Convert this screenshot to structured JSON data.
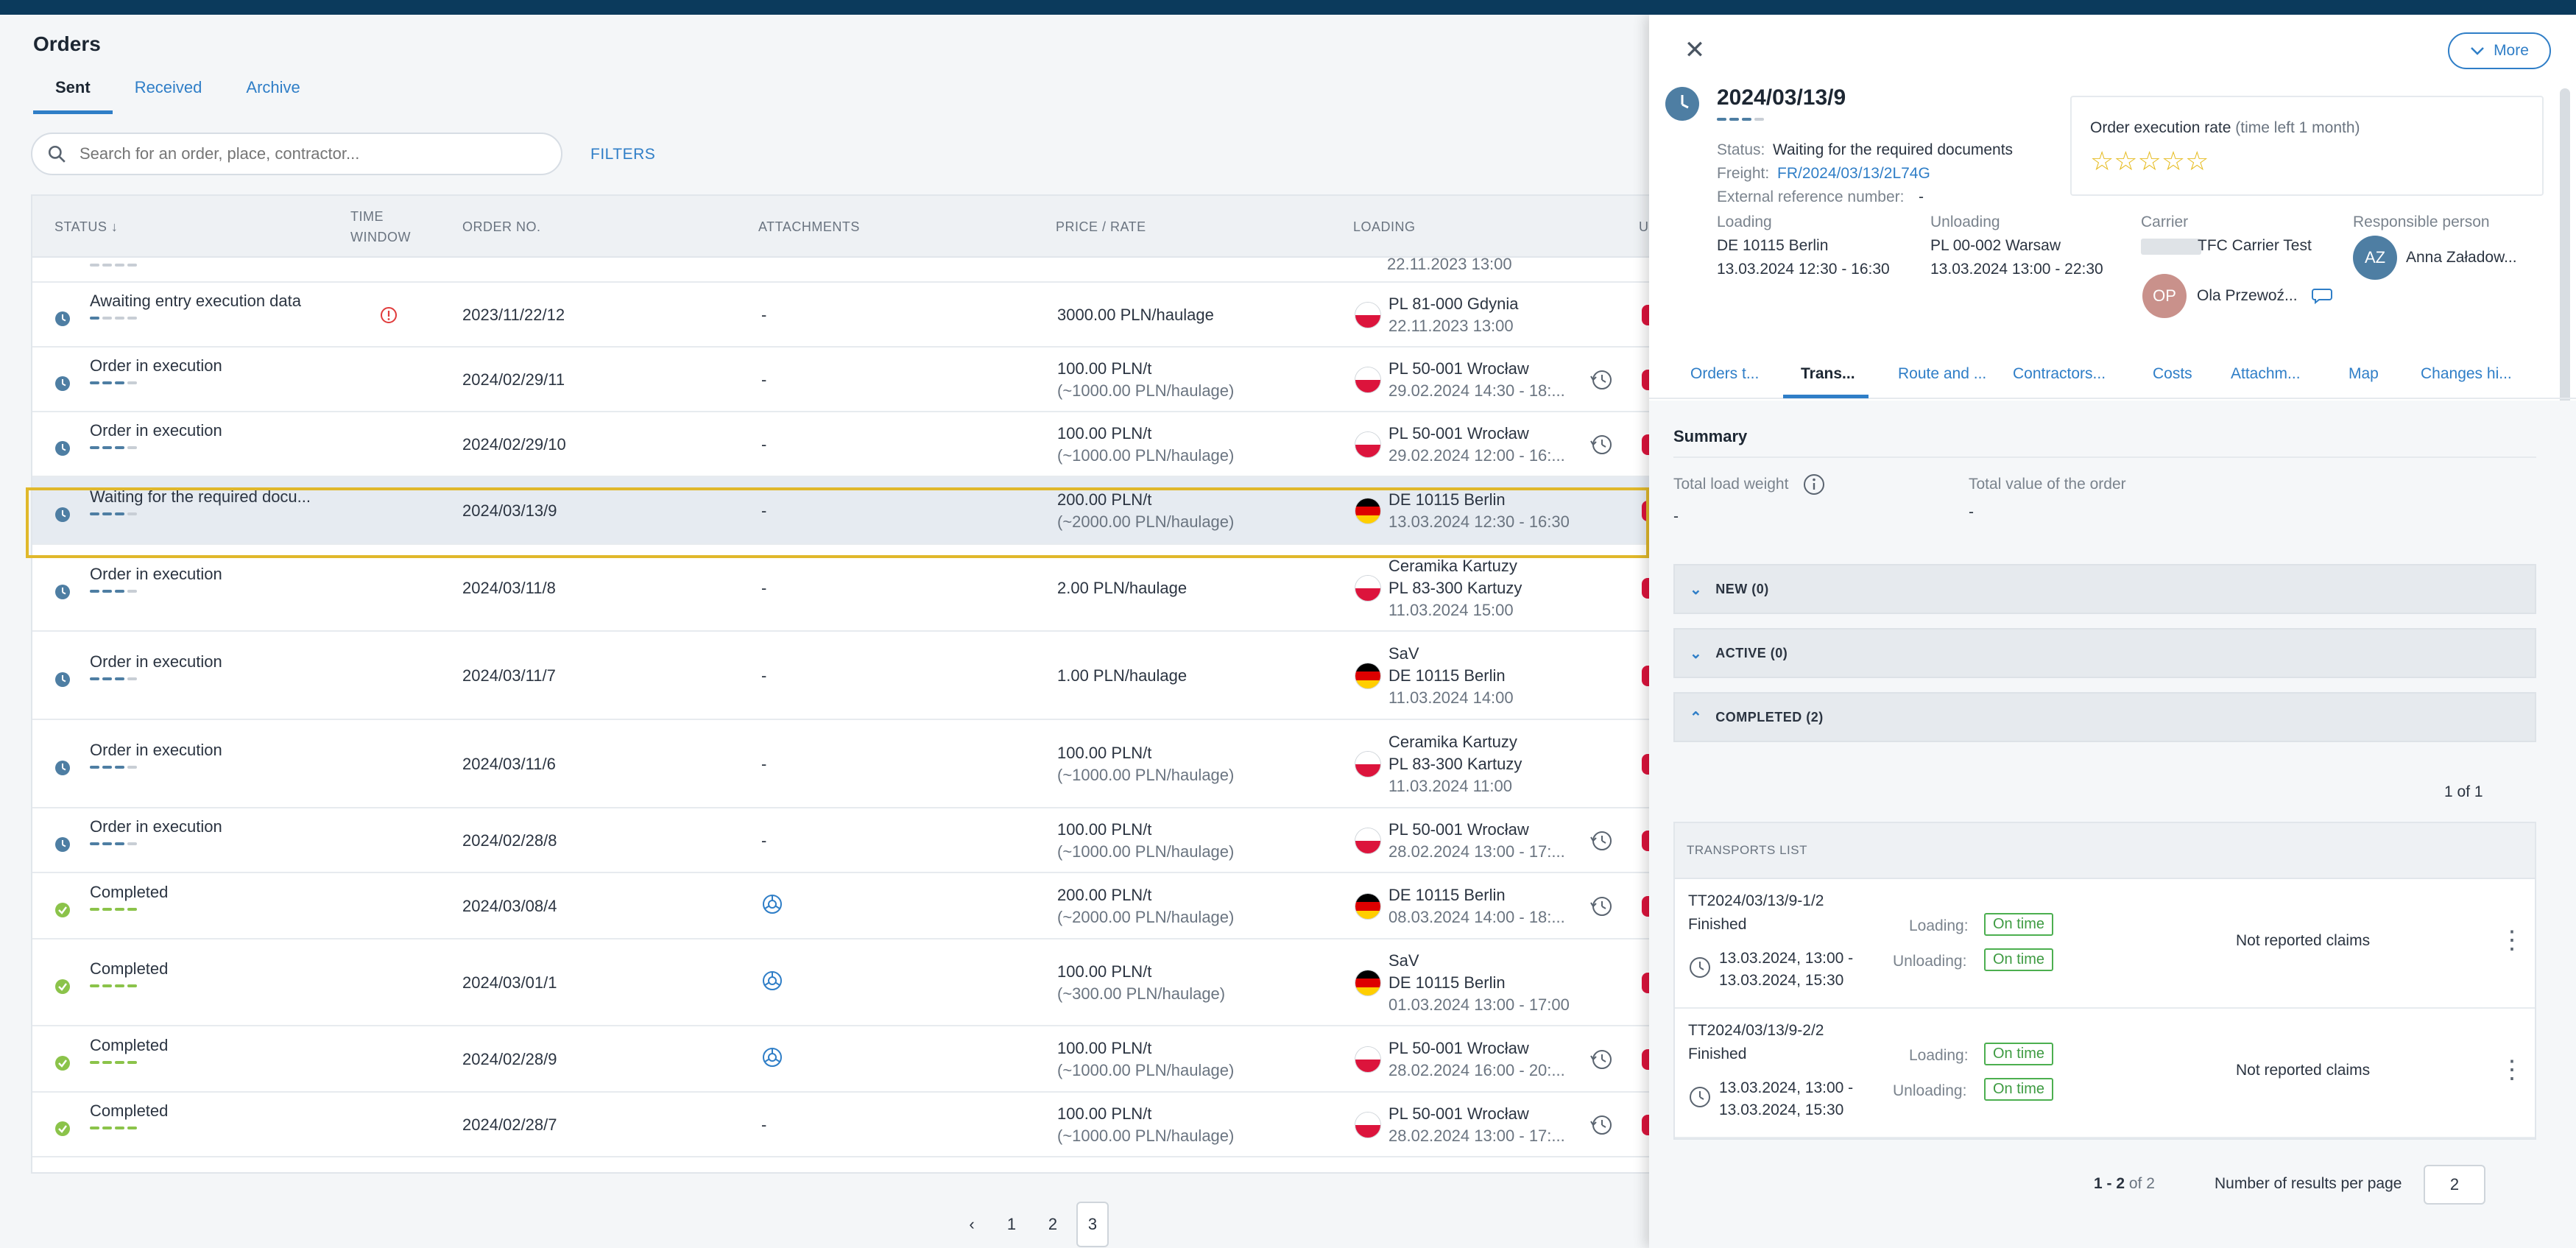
{
  "page": {
    "title": "Orders",
    "tabs": [
      "Sent",
      "Received",
      "Archive"
    ],
    "search_placeholder": "Search for an order, place, contractor...",
    "filters_label": "FILTERS"
  },
  "table": {
    "headers": {
      "status": "STATUS ↓",
      "time_window": "TIME\nWINDOW",
      "order_no": "ORDER NO.",
      "attachments": "ATTACHMENTS",
      "price": "PRICE / RATE",
      "loading": "LOADING",
      "unloading": "U"
    },
    "partial_row": {
      "loading_date": "22.11.2023 13:00"
    },
    "rows": [
      {
        "status": "Awaiting entry execution data",
        "kind": "pending",
        "alert": true,
        "order_no": "2023/11/22/12",
        "attachments": "-",
        "price1": "3000.00 PLN/haulage",
        "price2": "",
        "load_lines": [
          "PL 81-000 Gdynia",
          "22.11.2023 13:00"
        ],
        "flag": "pl",
        "history": false
      },
      {
        "status": "Order in execution",
        "kind": "exec",
        "alert": false,
        "order_no": "2024/02/29/11",
        "attachments": "-",
        "price1": "100.00 PLN/t",
        "price2": "(~1000.00 PLN/haulage)",
        "load_lines": [
          "PL 50-001 Wrocław",
          "29.02.2024 14:30 - 18:..."
        ],
        "flag": "pl",
        "history": true
      },
      {
        "status": "Order in execution",
        "kind": "exec",
        "alert": false,
        "order_no": "2024/02/29/10",
        "attachments": "-",
        "price1": "100.00 PLN/t",
        "price2": "(~1000.00 PLN/haulage)",
        "load_lines": [
          "PL 50-001 Wrocław",
          "29.02.2024 12:00 - 16:..."
        ],
        "flag": "pl",
        "history": true
      },
      {
        "status": "Waiting for the required docu...",
        "kind": "exec",
        "alert": false,
        "order_no": "2024/03/13/9",
        "attachments": "-",
        "price1": "200.00 PLN/t",
        "price2": "(~2000.00 PLN/haulage)",
        "load_lines": [
          "DE 10115 Berlin",
          "13.03.2024 12:30 - 16:30"
        ],
        "flag": "de",
        "history": false,
        "selected": true
      },
      {
        "status": "Order in execution",
        "kind": "exec",
        "alert": false,
        "order_no": "2024/03/11/8",
        "attachments": "-",
        "price1": "2.00 PLN/haulage",
        "price2": "",
        "load_lines": [
          "Ceramika Kartuzy",
          "PL 83-300 Kartuzy",
          "11.03.2024 15:00"
        ],
        "flag": "pl",
        "history": false
      },
      {
        "status": "Order in execution",
        "kind": "exec",
        "alert": false,
        "order_no": "2024/03/11/7",
        "attachments": "-",
        "price1": "1.00 PLN/haulage",
        "price2": "",
        "load_lines": [
          "SaV",
          "DE 10115 Berlin",
          "11.03.2024 14:00"
        ],
        "flag": "de",
        "history": false
      },
      {
        "status": "Order in execution",
        "kind": "exec",
        "alert": false,
        "order_no": "2024/03/11/6",
        "attachments": "-",
        "price1": "100.00 PLN/t",
        "price2": "(~1000.00 PLN/haulage)",
        "load_lines": [
          "Ceramika Kartuzy",
          "PL 83-300 Kartuzy",
          "11.03.2024 11:00"
        ],
        "flag": "pl",
        "history": false
      },
      {
        "status": "Order in execution",
        "kind": "exec",
        "alert": false,
        "order_no": "2024/02/28/8",
        "attachments": "-",
        "price1": "100.00 PLN/t",
        "price2": "(~1000.00 PLN/haulage)",
        "load_lines": [
          "PL 50-001 Wrocław",
          "28.02.2024 13:00 - 17:..."
        ],
        "flag": "pl",
        "history": true
      },
      {
        "status": "Completed",
        "kind": "done",
        "alert": false,
        "order_no": "2024/03/08/4",
        "attachments": "icon",
        "price1": "200.00 PLN/t",
        "price2": "(~2000.00 PLN/haulage)",
        "load_lines": [
          "DE 10115 Berlin",
          "08.03.2024 14:00 - 18:..."
        ],
        "flag": "de",
        "history": true
      },
      {
        "status": "Completed",
        "kind": "done",
        "alert": false,
        "order_no": "2024/03/01/1",
        "attachments": "icon",
        "price1": "100.00 PLN/t",
        "price2": "(~300.00 PLN/haulage)",
        "load_lines": [
          "SaV",
          "DE 10115 Berlin",
          "01.03.2024 13:00 - 17:00"
        ],
        "flag": "de",
        "history": false
      },
      {
        "status": "Completed",
        "kind": "done",
        "alert": false,
        "order_no": "2024/02/28/9",
        "attachments": "icon",
        "price1": "100.00 PLN/t",
        "price2": "(~1000.00 PLN/haulage)",
        "load_lines": [
          "PL 50-001 Wrocław",
          "28.02.2024 16:00 - 20:..."
        ],
        "flag": "pl",
        "history": true
      },
      {
        "status": "Completed",
        "kind": "done",
        "alert": false,
        "order_no": "2024/02/28/7",
        "attachments": "-",
        "price1": "100.00 PLN/t",
        "price2": "(~1000.00 PLN/haulage)",
        "load_lines": [
          "PL 50-001 Wrocław",
          "28.02.2024 13:00 - 17:..."
        ],
        "flag": "pl",
        "history": true
      }
    ]
  },
  "pagination": {
    "prev": "‹",
    "pages": [
      "1",
      "2",
      "3"
    ],
    "active": "3"
  },
  "panel": {
    "close": "✕",
    "more_label": "More",
    "order_no": "2024/03/13/9",
    "status_label": "Status:",
    "status_value": "Waiting for the required documents",
    "freight_label": "Freight:",
    "freight_value": "FR/2024/03/13/2L74G",
    "extref_label": "External reference number:",
    "extref_value": "-",
    "rate_title": "Order execution rate",
    "rate_hint": "(time left 1 month)",
    "stars": "☆☆☆☆☆",
    "loading_label": "Loading",
    "loading_place": "DE 10115 Berlin",
    "loading_time": "13.03.2024 12:30 - 16:30",
    "unloading_label": "Unloading",
    "unloading_place": "PL 00-002 Warsaw",
    "unloading_time": "13.03.2024 13:00 - 22:30",
    "carrier_label": "Carrier",
    "carrier_name": "TFC Carrier Test",
    "carrier_person": "Ola Przewoź...",
    "carrier_initials": "OP",
    "responsible_label": "Responsible person",
    "responsible_name": "Anna Załadow...",
    "responsible_initials": "AZ",
    "tabs": [
      "Orders t...",
      "Trans...",
      "Route and ...",
      "Contractors...",
      "Costs",
      "Attachm...",
      "Map",
      "Changes hi..."
    ],
    "summary_title": "Summary",
    "total_weight_label": "Total load weight",
    "total_weight_value": "-",
    "total_value_label": "Total value of the order",
    "total_value_value": "-",
    "sections": [
      "NEW (0)",
      "ACTIVE (0)",
      "COMPLETED (2)"
    ],
    "page_info": "1 of 1",
    "transports_header": "TRANSPORTS LIST",
    "transports": [
      {
        "id": "TT2024/03/13/9-1/2",
        "state": "Finished",
        "loading_label": "Loading:",
        "loading_badge": "On time",
        "unloading_label": "Unloading:",
        "unloading_badge": "On time",
        "time1": "13.03.2024, 13:00 -",
        "time2": "13.03.2024, 15:30",
        "claims": "Not reported claims"
      },
      {
        "id": "TT2024/03/13/9-2/2",
        "state": "Finished",
        "loading_label": "Loading:",
        "loading_badge": "On time",
        "unloading_label": "Unloading:",
        "unloading_badge": "On time",
        "time1": "13.03.2024, 13:00 -",
        "time2": "13.03.2024, 15:30",
        "claims": "Not reported claims"
      }
    ],
    "results_range": "1 - 2",
    "results_of": "of 2",
    "per_page_label": "Number of results per page",
    "per_page_value": "2"
  }
}
